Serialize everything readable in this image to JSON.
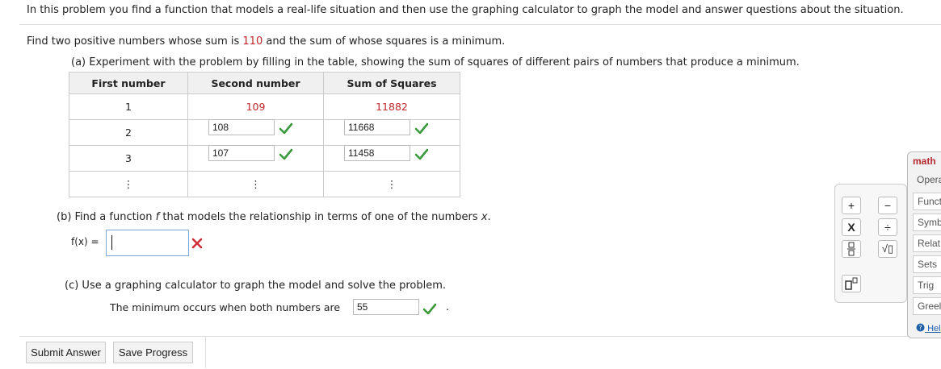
{
  "intro": "In this problem you find a function that models a real-life situation and then use the graphing calculator to graph the model and answer questions about the situation.",
  "problem": {
    "prefix": "Find two positive numbers whose sum is ",
    "sum": "110",
    "suffix": " and the sum of whose squares is a minimum."
  },
  "part_a": {
    "prompt": "(a) Experiment with the problem by filling in the table, showing the sum of squares of different pairs of numbers that produce a minimum.",
    "headers": [
      "First number",
      "Second number",
      "Sum of Squares"
    ],
    "rows": [
      {
        "first": "1",
        "second": "109",
        "sum": "11882"
      },
      {
        "first": "2",
        "second": "108",
        "sum": "11668"
      },
      {
        "first": "3",
        "second": "107",
        "sum": "11458"
      },
      {
        "first": "⋮",
        "second": "⋮",
        "sum": "⋮"
      }
    ]
  },
  "part_b": {
    "prompt_pre": "(b) Find a function ",
    "f": "f",
    "prompt_post": " that models the relationship in terms of one of the numbers ",
    "x": "x",
    "dot": ".",
    "label": "f(x) =",
    "value": ""
  },
  "part_c": {
    "prompt": "(c) Use a graphing calculator to graph the model and solve the problem.",
    "answer_label": "The minimum occurs when both numbers are",
    "value": "55",
    "end": "."
  },
  "buttons": {
    "submit": "Submit Answer",
    "save": "Save Progress"
  },
  "keypad": {
    "plus": "+",
    "minus": "−",
    "times": "X",
    "divide": "÷",
    "sqrt": "√▯"
  },
  "math_panel": {
    "title": "math",
    "tabs": [
      "Opera",
      "Funct",
      "Symb",
      "Relat",
      "Sets",
      "Trig",
      "Greel"
    ],
    "help": "Hel"
  },
  "colors": {
    "correct": "#3a9a3a",
    "wrong": "#d0303a",
    "highlight": "#c0262b"
  }
}
